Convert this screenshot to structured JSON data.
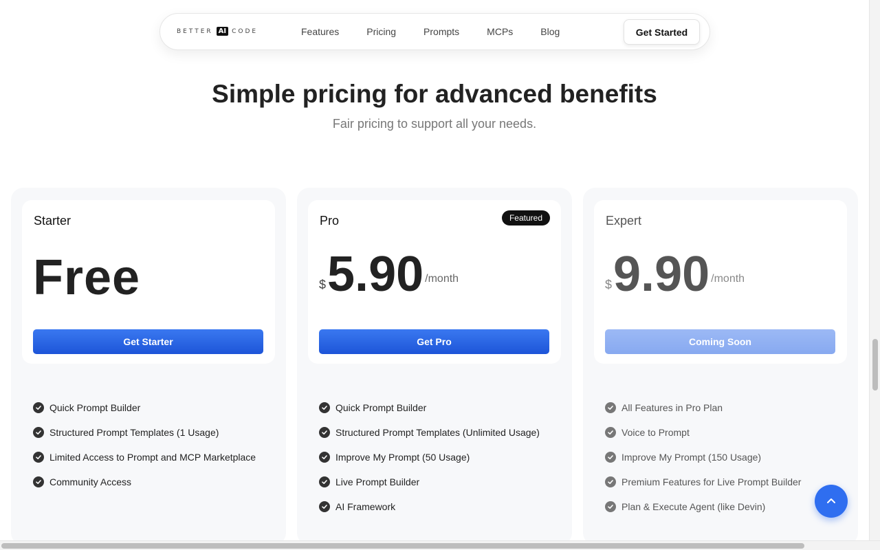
{
  "nav": {
    "logo_left": "BETTER",
    "logo_mid": "AI",
    "logo_right": "CODE",
    "links": [
      "Features",
      "Pricing",
      "Prompts",
      "MCPs",
      "Blog"
    ],
    "cta": "Get Started"
  },
  "hero": {
    "title": "Simple pricing for advanced benefits",
    "subtitle": "Fair pricing to support all your needs."
  },
  "plans": [
    {
      "name": "Starter",
      "price": "Free",
      "button": "Get Starter",
      "features": [
        "Quick Prompt Builder",
        "Structured Prompt Templates (1 Usage)",
        "Limited Access to Prompt and MCP Marketplace",
        "Community Access"
      ]
    },
    {
      "name": "Pro",
      "badge": "Featured",
      "currency": "$",
      "amount": "5.90",
      "period": "/month",
      "button": "Get Pro",
      "features": [
        "Quick Prompt Builder",
        "Structured Prompt Templates (Unlimited Usage)",
        "Improve My Prompt (50 Usage)",
        "Live Prompt Builder",
        "AI Framework"
      ]
    },
    {
      "name": "Expert",
      "currency": "$",
      "amount": "9.90",
      "period": "/month",
      "button": "Coming Soon",
      "features": [
        "All Features in Pro Plan",
        "Voice to Prompt",
        "Improve My Prompt (150 Usage)",
        "Premium Features for Live Prompt Builder",
        "Plan & Execute Agent (like Devin)"
      ]
    }
  ],
  "colors": {
    "accent": "#2f6ef0",
    "button": "#1d55d8",
    "button_disabled": "#9cb9f5",
    "badge": "#111111"
  },
  "icons": {
    "feature": "check-circle-icon",
    "scroll_top": "chevron-up-icon"
  }
}
